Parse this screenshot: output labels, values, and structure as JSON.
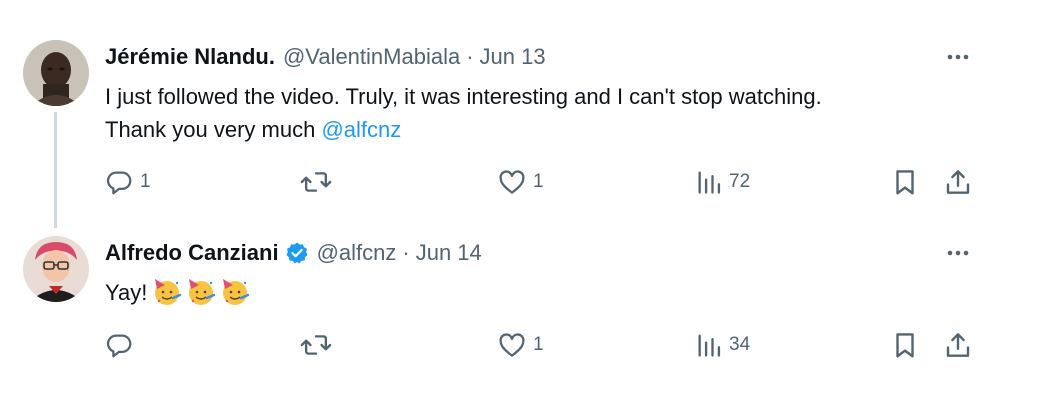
{
  "tweets": [
    {
      "author_name": "Jérémie Nlandu.",
      "handle": "@ValentinMabiala",
      "separator": "·",
      "date": "Jun 13",
      "verified": false,
      "text_line1": "I just followed the video. Truly, it was interesting and I can't stop watching.",
      "text_line2_prefix": "Thank you very much ",
      "mention": "@alfcnz",
      "reply_count": "1",
      "repost_count": "",
      "like_count": "1",
      "view_count": "72",
      "avatar_color": "#5b4a3f"
    },
    {
      "author_name": "Alfredo Canziani",
      "handle": "@alfcnz",
      "separator": "·",
      "date": "Jun 14",
      "verified": true,
      "text": "Yay!",
      "emojis": [
        "partying-face-emoji",
        "partying-face-emoji",
        "partying-face-emoji"
      ],
      "reply_count": "",
      "repost_count": "",
      "like_count": "1",
      "view_count": "34",
      "avatar_color": "#c94a5e"
    }
  ],
  "colors": {
    "text_primary": "#0f1419",
    "text_secondary": "#536471",
    "accent": "#1d9bf0",
    "thread_line": "#cfd9de"
  },
  "icons": {
    "reply": "reply-icon",
    "repost": "repost-icon",
    "like": "heart-icon",
    "views": "views-icon",
    "bookmark": "bookmark-icon",
    "share": "share-icon",
    "more": "more-icon",
    "verified": "verified-badge-icon"
  }
}
